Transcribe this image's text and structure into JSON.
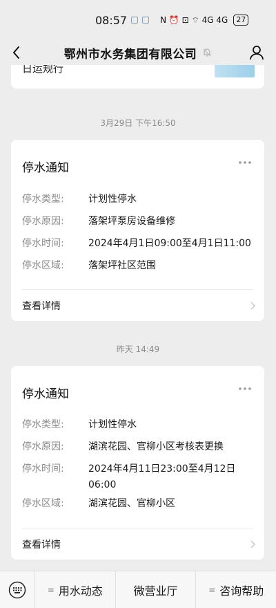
{
  "status": {
    "time": "08:57",
    "indicators": "N ⏰ ⊡ ⌔ 4G 4G",
    "battery": "27"
  },
  "nav": {
    "title": "鄂州市水务集团有限公司"
  },
  "feed": {
    "previous_card_text": "日运规行",
    "messages": [
      {
        "timestamp": "3月29日 下午16:50",
        "title": "停水通知",
        "fields": [
          {
            "label": "停水类型:",
            "value": "计划性停水"
          },
          {
            "label": "停水原因:",
            "value": "落架坪泵房设备维修"
          },
          {
            "label": "停水时间:",
            "value": "2024年4月1日09:00至4月1日11:00"
          },
          {
            "label": "停水区域:",
            "value": "落架坪社区范围"
          }
        ],
        "detail_label": "查看详情"
      },
      {
        "timestamp": "昨天 14:49",
        "title": "停水通知",
        "fields": [
          {
            "label": "停水类型:",
            "value": "计划性停水"
          },
          {
            "label": "停水原因:",
            "value": "湖滨花园、官柳小区考核表更换"
          },
          {
            "label": "停水时间:",
            "value": "2024年4月11日23:00至4月12日06:00"
          },
          {
            "label": "停水区域:",
            "value": "湖滨花园、官柳小区"
          }
        ],
        "detail_label": "查看详情"
      }
    ]
  },
  "bottom_menu": {
    "items": [
      {
        "label": "用水动态",
        "has_submenu": true
      },
      {
        "label": "微营业厅",
        "has_submenu": false
      },
      {
        "label": "咨询帮助",
        "has_submenu": true
      }
    ],
    "submenu_icon": "≡"
  },
  "icons": {
    "back": "chevron-left-icon",
    "mute": "bell-off-icon",
    "profile": "person-icon",
    "more": "more-dots-icon",
    "keyboard": "keyboard-icon",
    "detail": "chevron-right-icon"
  },
  "colors": {
    "background": "#ededed",
    "card": "#ffffff",
    "label_gray": "#8a8a8a",
    "text": "#1a1a1a"
  }
}
